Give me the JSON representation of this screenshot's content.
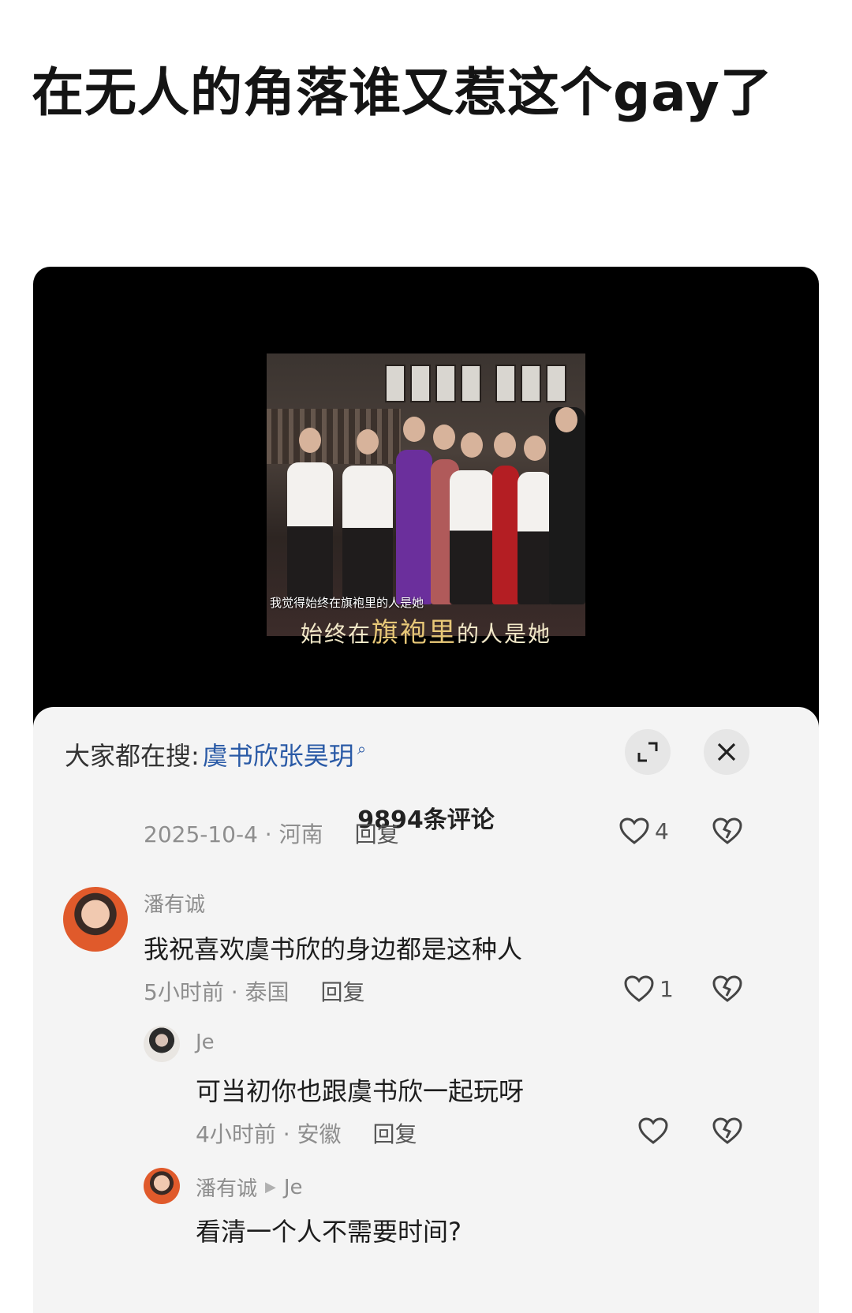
{
  "post": {
    "title": "在无人的角落谁又惹这个gay了"
  },
  "video": {
    "in_frame_caption": "我觉得始终在旗袍里的人是她",
    "subtitle_before": "始终在",
    "subtitle_highlight": "旗袍里",
    "subtitle_after": "的人是她"
  },
  "comments_sheet": {
    "search_prefix": "大家都在搜:",
    "search_term": "虞书欣张昊玥",
    "count_label": "9894条评论",
    "expand_icon": "expand-icon",
    "close_icon": "close-icon",
    "first_meta": {
      "time_location": "2025-10-4 · 河南",
      "reply_label": "回复",
      "likes": "4"
    },
    "comment_1": {
      "username": "潘有诚",
      "text": "我祝喜欢虞书欣的身边都是这种人",
      "time_location": "5小时前 · 泰国",
      "reply_label": "回复",
      "likes": "1"
    },
    "reply_1": {
      "username": "Je",
      "text": "可当初你也跟虞书欣一起玩呀",
      "time_location": "4小时前 · 安徽",
      "reply_label": "回复",
      "likes": ""
    },
    "reply_2": {
      "username": "潘有诚",
      "reply_to": "Je",
      "text": "看清一个人不需要时间?"
    }
  }
}
